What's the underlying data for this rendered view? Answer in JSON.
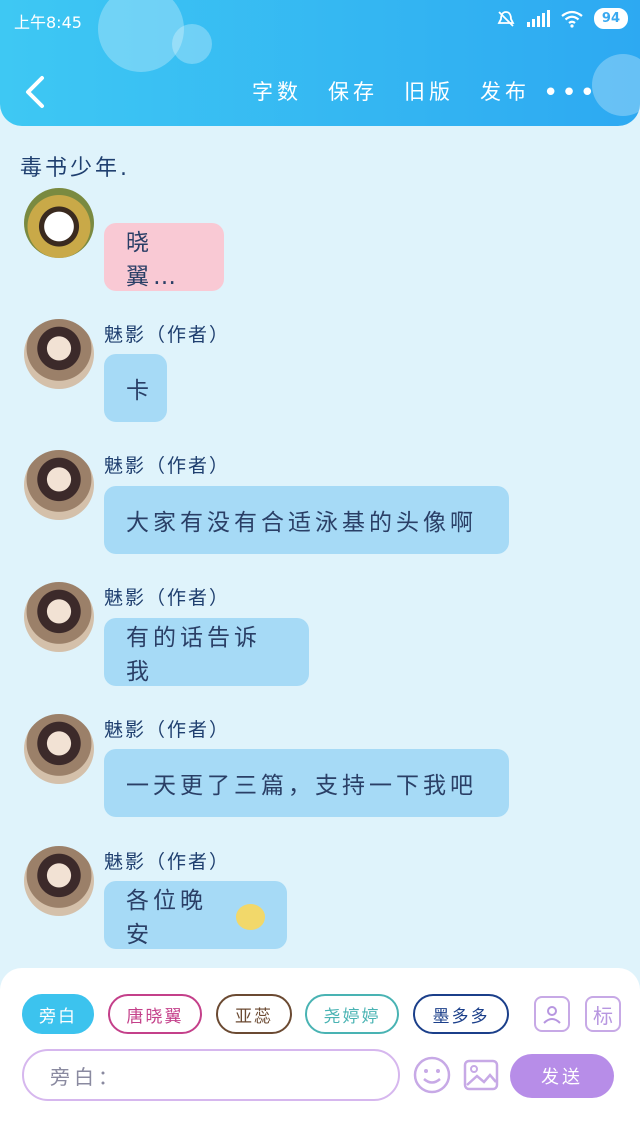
{
  "status_bar": {
    "time": "上午8:45",
    "battery": "94"
  },
  "header": {
    "actions": [
      "字数",
      "保存",
      "旧版",
      "发布"
    ],
    "more": "•••"
  },
  "document": {
    "title": "毒书少年."
  },
  "messages": [
    {
      "name": "",
      "text": "晓翼…",
      "style": "pink"
    },
    {
      "name": "魅影（作者）",
      "text": "卡",
      "style": "blue"
    },
    {
      "name": "魅影（作者）",
      "text": "大家有没有合适泳基的头像啊",
      "style": "blue"
    },
    {
      "name": "魅影（作者）",
      "text": "有的话告诉我",
      "style": "blue"
    },
    {
      "name": "魅影（作者）",
      "text": "一天更了三篇，支持一下我吧",
      "style": "blue"
    },
    {
      "name": "魅影（作者）",
      "text": "各位晚安",
      "style": "blue",
      "emoji": "sleepy-face-icon"
    }
  ],
  "roles": [
    {
      "label": "旁白",
      "color": "#3cc3ee",
      "selected": true
    },
    {
      "label": "唐晓翼",
      "color": "#c4408a",
      "selected": false
    },
    {
      "label": "亚蕊",
      "color": "#6b4a32",
      "selected": false
    },
    {
      "label": "尧婷婷",
      "color": "#49b3b3",
      "selected": false
    },
    {
      "label": "墨多多",
      "color": "#1b3f8a",
      "selected": false
    }
  ],
  "tools": {
    "character_icon": "person-card-icon",
    "mark_label": "标"
  },
  "composer": {
    "placeholder": "旁白：",
    "send_label": "发送"
  },
  "colors": {
    "header": "#2da9f2",
    "bubble_blue": "#a6daf6",
    "bubble_pink": "#f9c9d4",
    "send": "#b78de8"
  }
}
